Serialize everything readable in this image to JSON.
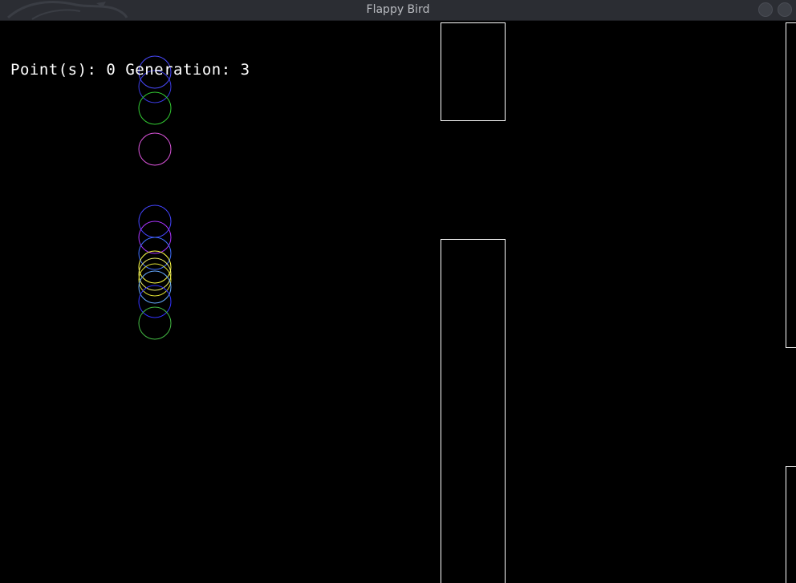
{
  "window": {
    "title": "Flappy Bird"
  },
  "hud": {
    "points_label": "Point(s):",
    "points": "0",
    "generation_label": "Generation:",
    "generation": "3"
  },
  "colors": {
    "background": "#000000",
    "pipe_stroke": "#ffffff",
    "hud_text": "#ffffff",
    "titlebar": "#2b2d33",
    "title_text": "#b9bbc0"
  },
  "icons": {
    "logo": "dragon-logo-icon",
    "button_1": "circle-button-icon",
    "button_2": "circle-button-icon"
  },
  "birds": [
    {
      "color": "#4a4aff"
    },
    {
      "color": "#3a3ae0"
    },
    {
      "color": "#33cc33"
    },
    {
      "color": "#dd55dd"
    },
    {
      "color": "#4444ff"
    },
    {
      "color": "#aa33ff"
    },
    {
      "color": "#3f6fff"
    },
    {
      "color": "#ffff44"
    },
    {
      "color": "#eeee66"
    },
    {
      "color": "#dddd33"
    },
    {
      "color": "#66aaff"
    },
    {
      "color": "#3333ff"
    },
    {
      "color": "#44bb44"
    }
  ]
}
